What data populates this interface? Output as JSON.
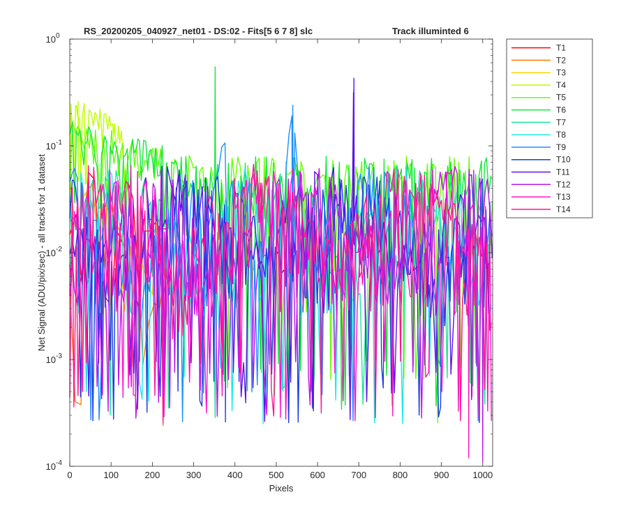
{
  "chart_data": {
    "type": "line",
    "title": "RS_20200205_040927_net01 - DS:02 - Fits[5  6  7  8]   slc",
    "subtitle": "Track illuminted 6",
    "xlabel": "Pixels",
    "ylabel": "Net Signal (ADU/pix/sec) - all tracks for 1 dataset",
    "xlim": [
      0,
      1024
    ],
    "ylim": [
      0.0001,
      1
    ],
    "yscale": "log",
    "grid": false,
    "legend_position": "outside-right-top",
    "x_ticks": [
      "0",
      "100",
      "200",
      "300",
      "400",
      "500",
      "600",
      "700",
      "800",
      "900",
      "1000"
    ],
    "y_ticks": [
      {
        "base": "10",
        "exp": "0"
      },
      {
        "base": "10",
        "exp": "-1"
      },
      {
        "base": "10",
        "exp": "-2"
      },
      {
        "base": "10",
        "exp": "-3"
      },
      {
        "base": "10",
        "exp": "-4"
      }
    ],
    "series": [
      {
        "name": "T1",
        "color": "#ff0000"
      },
      {
        "name": "T2",
        "color": "#ff7f00"
      },
      {
        "name": "T3",
        "color": "#ffd700"
      },
      {
        "name": "T4",
        "color": "#bfff00"
      },
      {
        "name": "T5",
        "color": "#66ff00"
      },
      {
        "name": "T6",
        "color": "#14e83a"
      },
      {
        "name": "T7",
        "color": "#1ae89a"
      },
      {
        "name": "T8",
        "color": "#1ae8e8"
      },
      {
        "name": "T9",
        "color": "#1a90ff"
      },
      {
        "name": "T10",
        "color": "#1a3cdd"
      },
      {
        "name": "T11",
        "color": "#5b14ea"
      },
      {
        "name": "T12",
        "color": "#c014ea"
      },
      {
        "name": "T13",
        "color": "#ff14c8"
      },
      {
        "name": "T14",
        "color": "#ff1493"
      }
    ],
    "annotations": [
      {
        "series": "T2",
        "x": 226,
        "y": 0.00024
      },
      {
        "series": "T4",
        "x": 20,
        "y": 0.26
      },
      {
        "series": "T6",
        "x": 352,
        "y": 0.55
      },
      {
        "series": "T9",
        "x": 540,
        "y": 0.24
      },
      {
        "series": "T11",
        "x": 688,
        "y": 0.43
      },
      {
        "series": "T10",
        "x": 377,
        "y": 0.00026
      },
      {
        "series": "T8",
        "x": 468,
        "y": 0.00025
      },
      {
        "series": "T13",
        "x": 966,
        "y": 0.00012
      },
      {
        "series": "T12",
        "x": 1000,
        "y": 0.00011
      }
    ]
  }
}
